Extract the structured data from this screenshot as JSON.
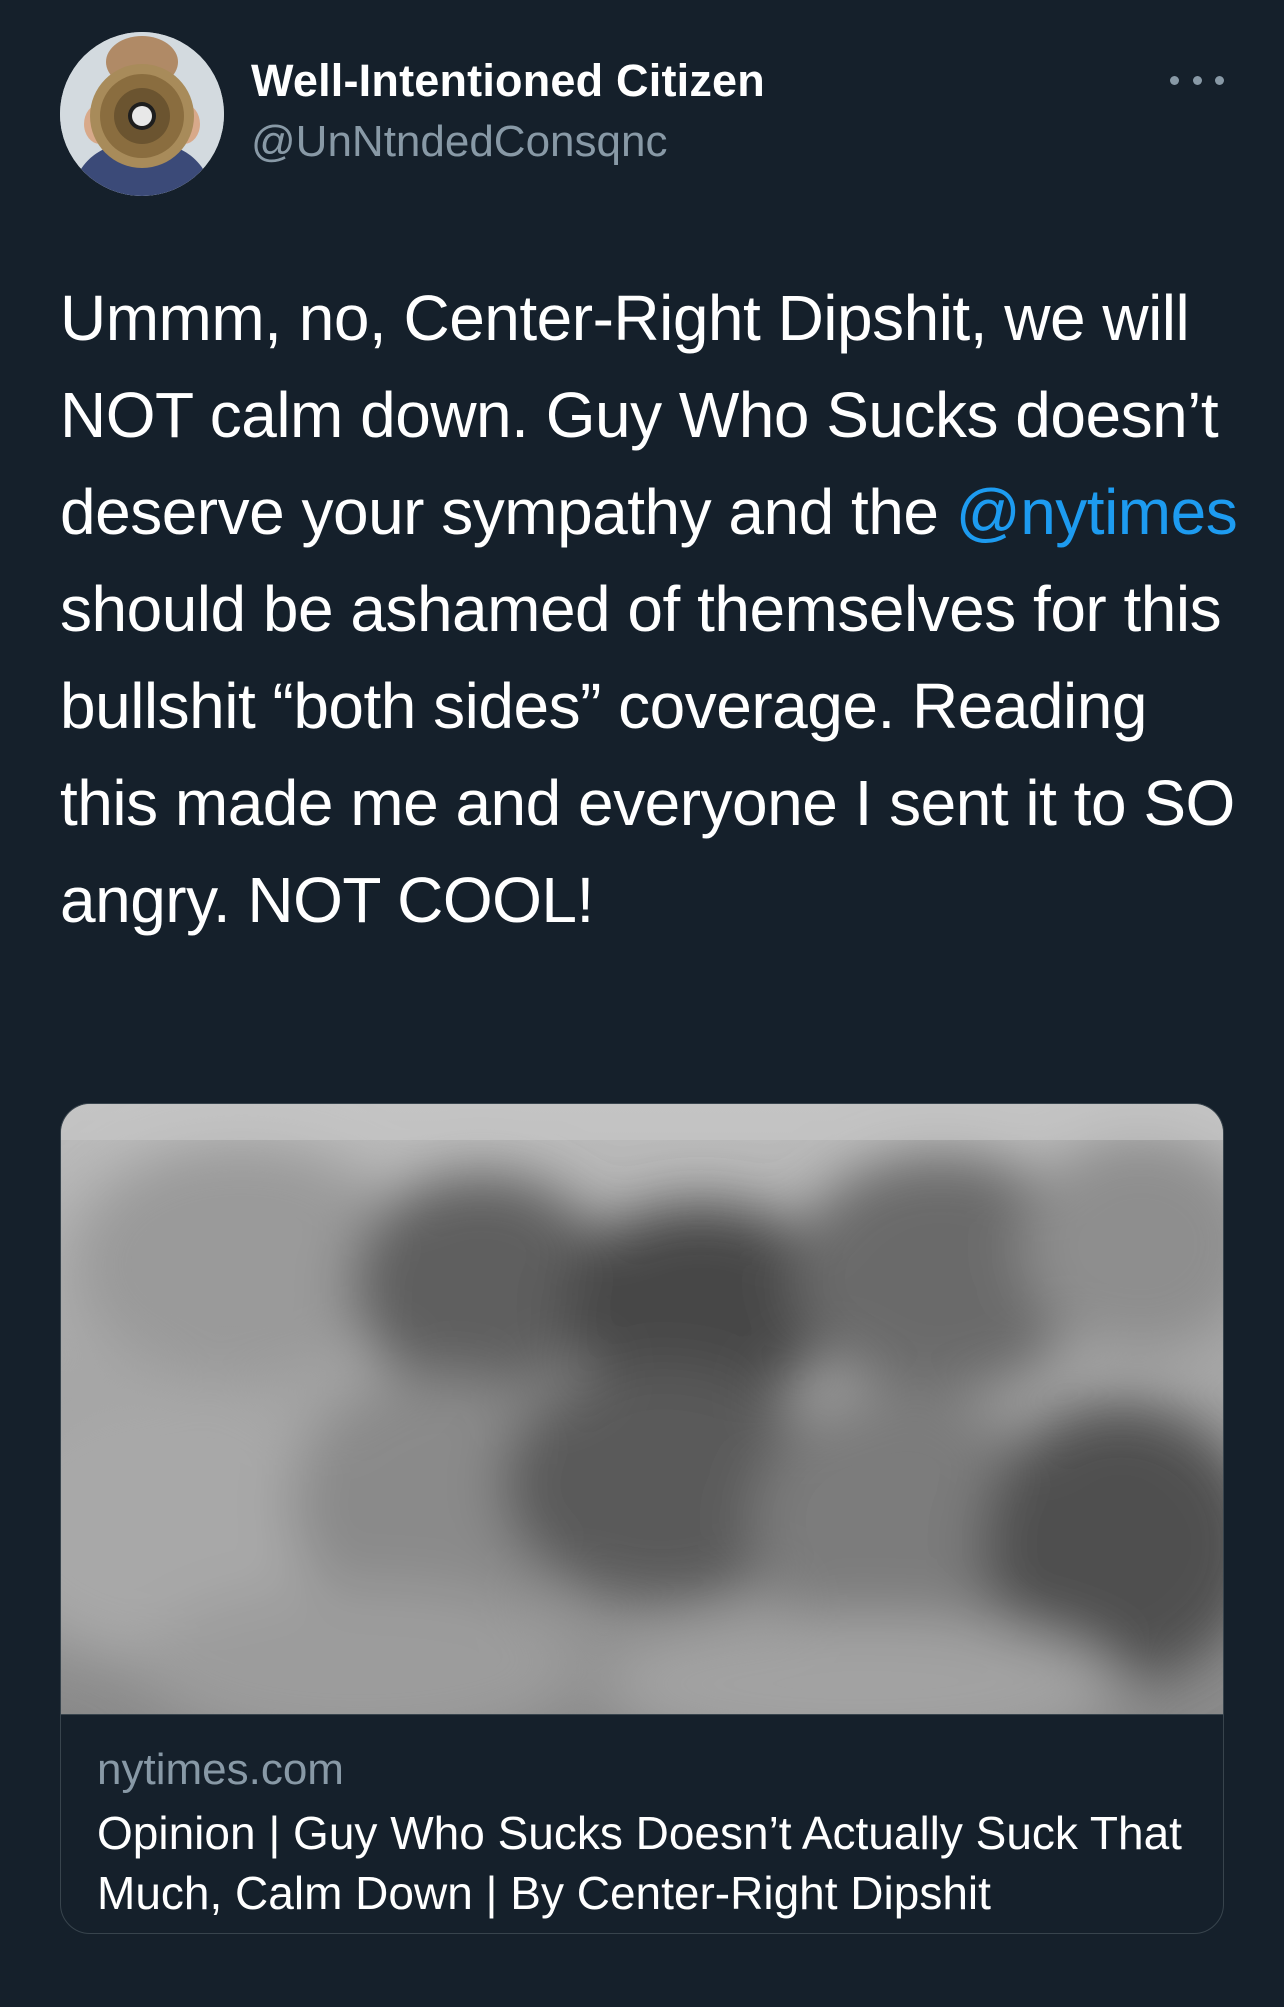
{
  "tweet": {
    "author": {
      "display_name": "Well-Intentioned Citizen",
      "handle": "@UnNtndedConsqnc",
      "avatar_icon": "person-with-megaphone"
    },
    "more_icon": "more-options-icon",
    "text": {
      "part1": "Ummm, no, Center-Right Dipshit, we will NOT calm down. Guy Who Sucks doesn’t deserve your sympathy and the ",
      "mention": "@nytimes",
      "part2": " should be ashamed of themselves for this bullshit “both sides” coverage. Reading this made me and everyone I sent it to SO angry. NOT COOL!"
    },
    "link_card": {
      "domain": "nytimes.com",
      "title": "Opinion | Guy Who Sucks Doesn’t Actually Suck That Much, Calm Down | By Center-Right Dipshit"
    }
  },
  "colors": {
    "background": "#15202b",
    "text_primary": "#ffffff",
    "text_secondary": "#8899a6",
    "link": "#1d9bf0",
    "border": "#38444d"
  }
}
